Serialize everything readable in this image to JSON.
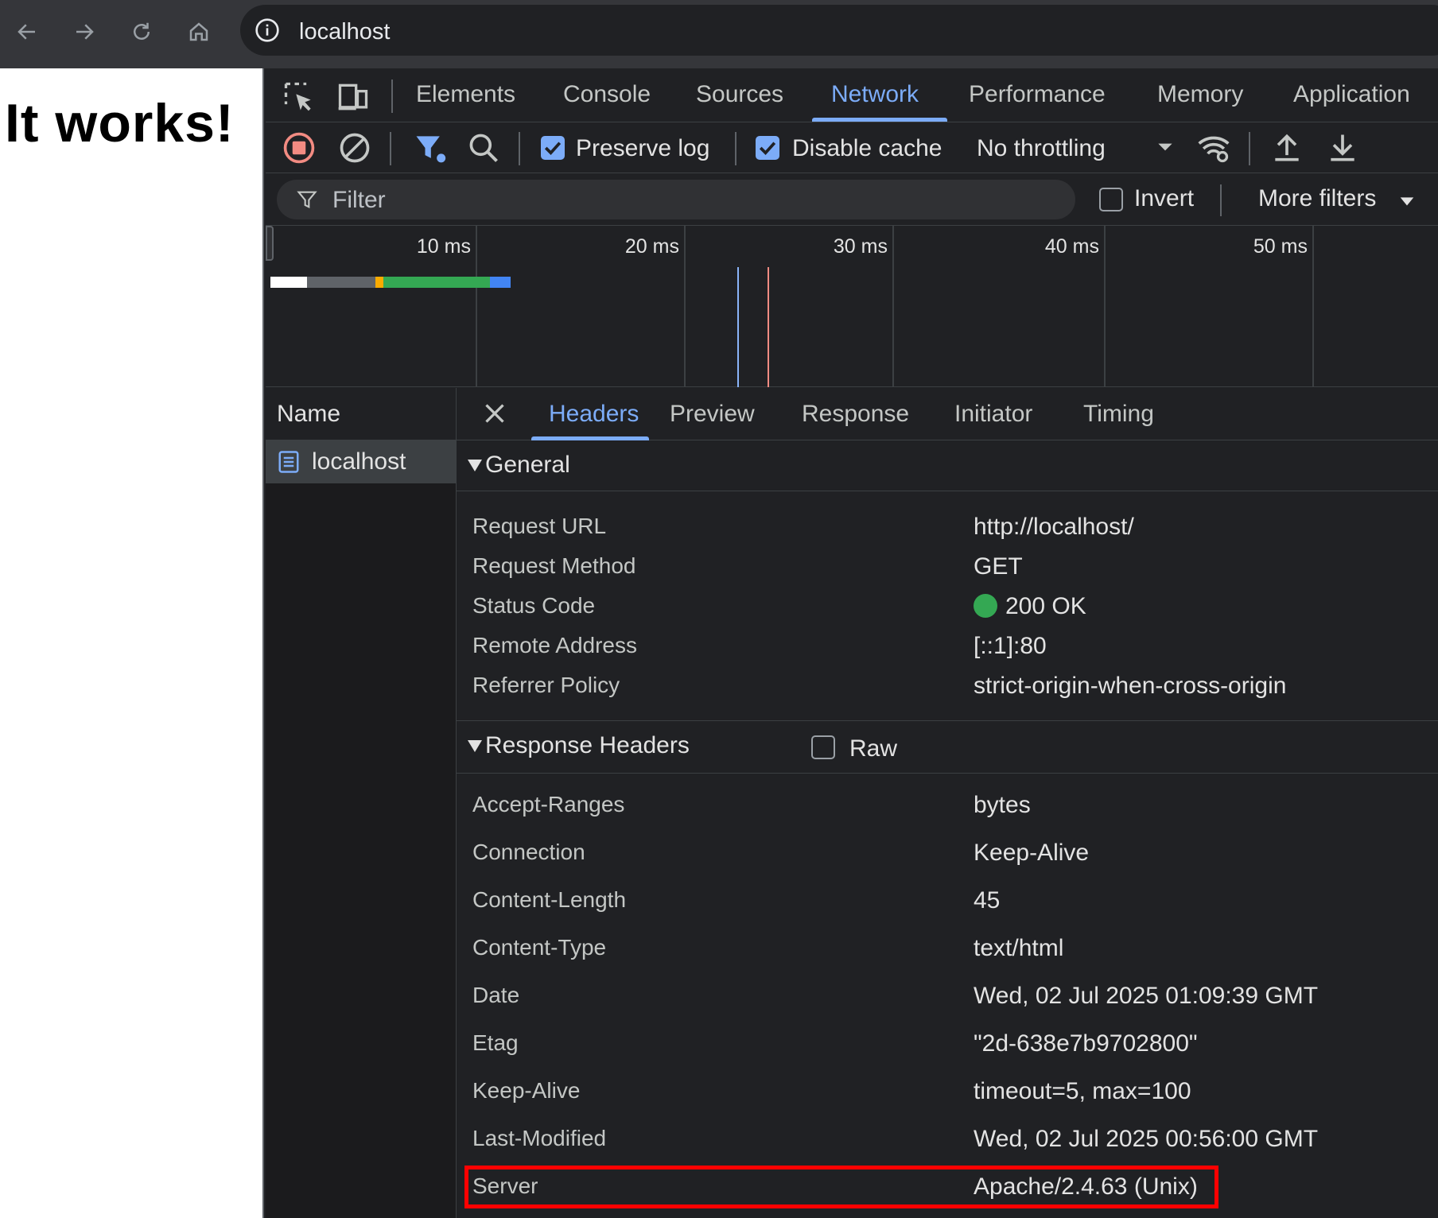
{
  "browser": {
    "url": "localhost",
    "nav_icons": [
      "back-icon",
      "forward-icon",
      "reload-icon",
      "home-icon"
    ],
    "info_icon": "info-icon"
  },
  "page": {
    "heading": "It works!"
  },
  "devtools": {
    "panel_tabs": [
      "Elements",
      "Console",
      "Sources",
      "Network",
      "Performance",
      "Memory",
      "Application"
    ],
    "active_panel": "Network",
    "toolbar": {
      "preserve_log": {
        "label": "Preserve log",
        "checked": true
      },
      "disable_cache": {
        "label": "Disable cache",
        "checked": true
      },
      "throttling": "No throttling"
    },
    "filter": {
      "placeholder": "Filter",
      "invert_label": "Invert",
      "invert_checked": false,
      "more_filters": "More filters"
    },
    "timeline": {
      "ticks": [
        "10 ms",
        "20 ms",
        "30 ms",
        "40 ms",
        "50 ms"
      ],
      "colors": {
        "queueing": "#ffffff",
        "stalled": "#5f6368",
        "ssl": "#f9ab00",
        "waiting": "#34a853",
        "download": "#4285f4",
        "dom_content_loaded": "#8ab4f8",
        "load": "#f28b82"
      }
    },
    "requests": {
      "column_header": "Name",
      "rows": [
        {
          "name": "localhost",
          "selected": true
        }
      ]
    },
    "detail": {
      "tabs": [
        "Headers",
        "Preview",
        "Response",
        "Initiator",
        "Timing"
      ],
      "active_tab": "Headers",
      "general": {
        "title": "General",
        "rows": [
          {
            "key": "Request URL",
            "value": "http://localhost/"
          },
          {
            "key": "Request Method",
            "value": "GET"
          },
          {
            "key": "Status Code",
            "value": "200 OK"
          },
          {
            "key": "Remote Address",
            "value": "[::1]:80"
          },
          {
            "key": "Referrer Policy",
            "value": "strict-origin-when-cross-origin"
          }
        ]
      },
      "response_headers": {
        "title": "Response Headers",
        "raw_label": "Raw",
        "raw_checked": false,
        "rows": [
          {
            "key": "Accept-Ranges",
            "value": "bytes"
          },
          {
            "key": "Connection",
            "value": "Keep-Alive"
          },
          {
            "key": "Content-Length",
            "value": "45"
          },
          {
            "key": "Content-Type",
            "value": "text/html"
          },
          {
            "key": "Date",
            "value": "Wed, 02 Jul 2025 01:09:39 GMT"
          },
          {
            "key": "Etag",
            "value": "\"2d-638e7b9702800\""
          },
          {
            "key": "Keep-Alive",
            "value": "timeout=5, max=100"
          },
          {
            "key": "Last-Modified",
            "value": "Wed, 02 Jul 2025 00:56:00 GMT"
          },
          {
            "key": "Server",
            "value": "Apache/2.4.63 (Unix)"
          }
        ]
      },
      "highlight_color": "#ff0000",
      "status_color": "#34a853"
    }
  }
}
